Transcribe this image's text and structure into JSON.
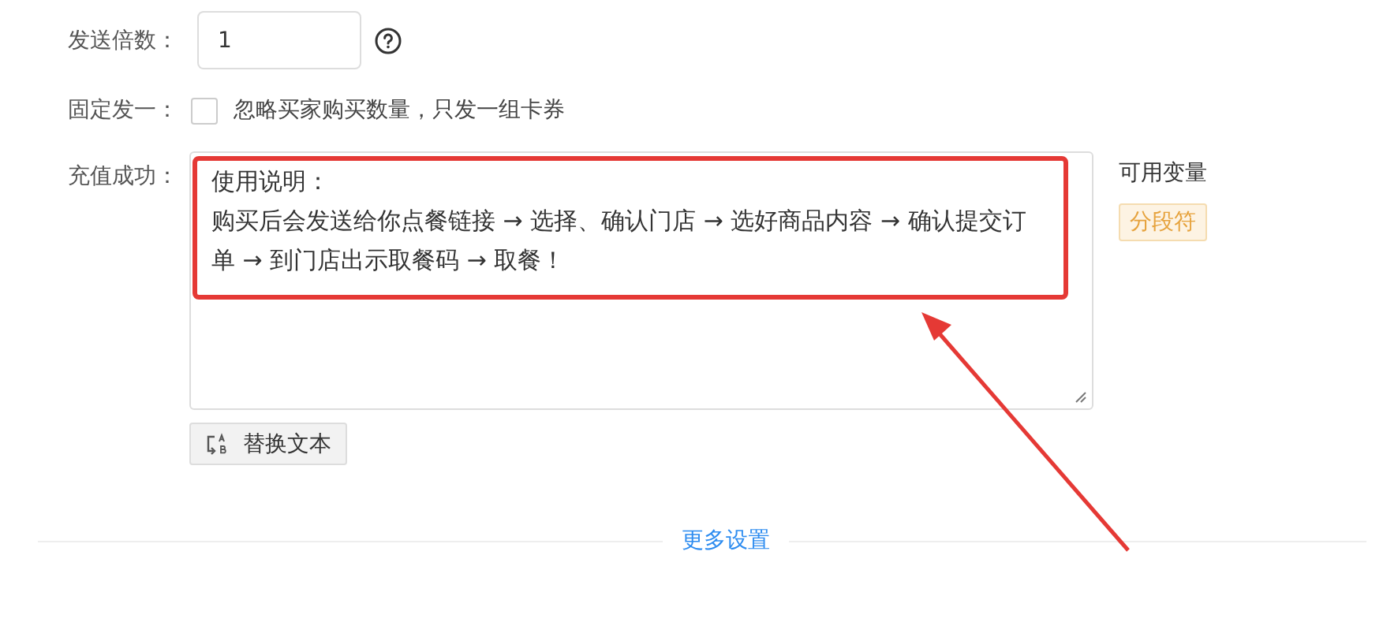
{
  "form": {
    "multiplier": {
      "label": "发送倍数：",
      "value": "1"
    },
    "fixed_one": {
      "label": "固定发一：",
      "checked": false,
      "text": "忽略买家购买数量，只发一组卡券"
    },
    "recharge_success": {
      "label": "充值成功：",
      "lines": [
        "使用说明：",
        "购买后会发送给你点餐链接 → 选择、确认门店 → 选好商品内容 → 确认提交订单 → 到门店出示取餐码 → 取餐！"
      ]
    },
    "variables": {
      "title": "可用变量",
      "tags": [
        "分段符"
      ]
    },
    "replace_button": "替换文本"
  },
  "more_settings": "更多设置",
  "annotation": {
    "highlight": true,
    "arrow": true
  }
}
